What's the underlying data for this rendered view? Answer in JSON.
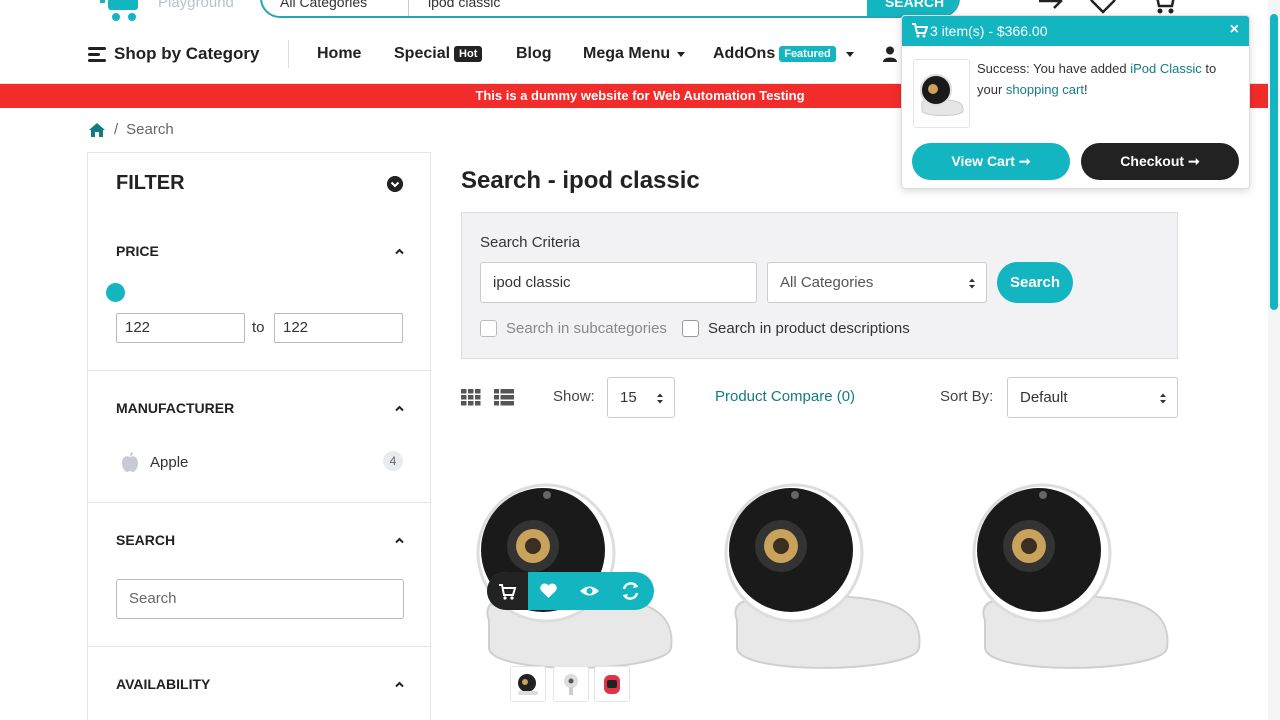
{
  "header": {
    "logo_text": "Playground",
    "search_category": "All Categories",
    "search_value": "ipod classic",
    "search_button": "SEARCH"
  },
  "nav": {
    "shop_by_category": "Shop by Category",
    "home": "Home",
    "special": "Special",
    "special_badge": "Hot",
    "blog": "Blog",
    "mega_menu": "Mega Menu",
    "addons": "AddOns",
    "addons_badge": "Featured"
  },
  "banner": "This is a dummy website for Web Automation Testing",
  "breadcrumb": {
    "current": "Search"
  },
  "filter": {
    "title": "FILTER",
    "price": {
      "title": "PRICE",
      "min": "122",
      "to": "to",
      "max": "122"
    },
    "manufacturer": {
      "title": "MANUFACTURER",
      "items": [
        {
          "name": "Apple",
          "count": "4"
        }
      ]
    },
    "search": {
      "title": "SEARCH",
      "placeholder": "Search"
    },
    "availability": {
      "title": "AVAILABILITY"
    }
  },
  "main": {
    "title": "Search - ipod classic",
    "criteria": {
      "label": "Search Criteria",
      "keyword": "ipod classic",
      "category": "All Categories",
      "button": "Search",
      "subcategories": "Search in subcategories",
      "descriptions": "Search in product descriptions"
    },
    "toolbar": {
      "show_label": "Show:",
      "show_value": "15",
      "compare": "Product Compare (0)",
      "sort_label": "Sort By:",
      "sort_value": "Default"
    }
  },
  "cart_popup": {
    "header": "3 item(s) - $366.00",
    "message_prefix": "Success: You have added ",
    "product_link": "iPod Classic",
    "message_mid": " to your ",
    "cart_link": "shopping cart",
    "message_suffix": "!",
    "view_cart": "View Cart",
    "checkout": "Checkout"
  },
  "colors": {
    "accent": "#13b5c0",
    "banner": "#f22b2b",
    "dark": "#222222"
  }
}
